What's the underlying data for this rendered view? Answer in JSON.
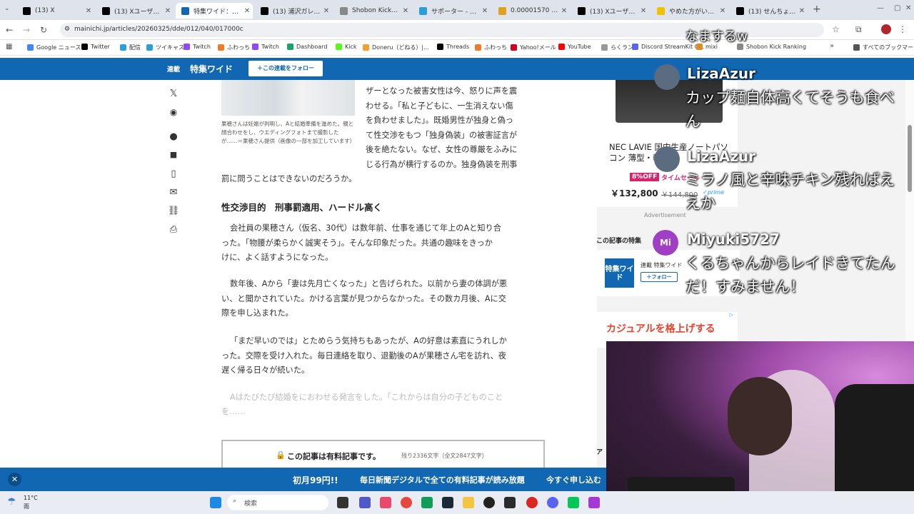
{
  "tabs": [
    {
      "label": "(13) X",
      "color": "#000000"
    },
    {
      "label": "(13) Xユーザーの新",
      "color": "#000000"
    },
    {
      "label": "特集ワイド：BeMe",
      "color": "#1167b1",
      "active": true
    },
    {
      "label": "(13) 浦沢ガレン（@",
      "color": "#000000"
    },
    {
      "label": "Shobon Kick Rank",
      "color": "#888888"
    },
    {
      "label": "サポーター - せんちょ",
      "color": "#2b9fd9"
    },
    {
      "label": "0.00001570 | AXS",
      "color": "#e0a020"
    },
    {
      "label": "(13) Xユーザーの新",
      "color": "#000000"
    },
    {
      "label": "やめた方がいい！ブ",
      "color": "#f2c200"
    },
    {
      "label": "(13) せんちょさん（@",
      "color": "#000000"
    }
  ],
  "address": {
    "url": "mainichi.jp/articles/20260325/dde/012/040/017000c"
  },
  "bookmarks": [
    {
      "label": "Google ニュース",
      "color": "#4285f4"
    },
    {
      "label": "Twitter",
      "color": "#000000"
    },
    {
      "label": "配信",
      "color": "#2b9fd9"
    },
    {
      "label": "ツイキャス",
      "color": "#2b9fd9"
    },
    {
      "label": "Twitch",
      "color": "#9146ff"
    },
    {
      "label": "ふわっち",
      "color": "#f07c2a"
    },
    {
      "label": "Twitch",
      "color": "#9146ff"
    },
    {
      "label": "Dashboard",
      "color": "#1aa36a"
    },
    {
      "label": "Kick",
      "color": "#53fc18"
    },
    {
      "label": "Doneru（どねる）|...",
      "color": "#f2a12e"
    },
    {
      "label": "Threads",
      "color": "#000000"
    },
    {
      "label": "ふわっち",
      "color": "#f07c2a"
    },
    {
      "label": "Yahoo!メール",
      "color": "#d1001c"
    },
    {
      "label": "YouTube",
      "color": "#ff0000"
    },
    {
      "label": "らくラン",
      "color": "#999999"
    },
    {
      "label": "Discord StreamKit O...",
      "color": "#5865f2"
    },
    {
      "label": "mixi",
      "color": "#e28a1f"
    },
    {
      "label": "Shobon Kick Ranking",
      "color": "#888888"
    },
    {
      "label": "すべてのブックマーク",
      "color": "#555555"
    }
  ],
  "site_header": {
    "series": "連載",
    "name": "特集ワイド",
    "follow_button": "＋この連載をフォロー"
  },
  "article": {
    "caption": "果穂さんは妊娠が判明し、Aと結婚準備を進めた。親と顔合わせをし、ウエディングフォトまで撮影したが……＝果穂さん提供（画像の一部を加工しています）",
    "intro_lines": [
      "ザーとなった被害女性は今、怒りに声を震",
      "わせる。「私と子どもに、一生消えない傷",
      "を負わせました」。既婚男性が独身と偽っ",
      "て性交渉をもつ「独身偽装」の被害証言が",
      "後を絶たない。なぜ、女性の尊厳をふみに",
      "じる行為が横行するのか。独身偽装を刑事"
    ],
    "intro_last": "罰に問うことはできないのだろうか。",
    "heading": "性交渉目的　刑事罰適用、ハードル高く",
    "p1": [
      "会社員の果穂さん（仮名、30代）は数年前、仕事を通じて年上のAと知り合",
      "った。「物腰が柔らかく誠実そう」。そんな印象だった。共通の趣味をきっか",
      "けに、よく話すようになった。"
    ],
    "p2": [
      "数年後、Aから「妻は先月亡くなった」と告げられた。以前から妻の体調が悪",
      "い、と聞かされていた。かける言葉が見つからなかった。その数カ月後、Aに交",
      "際を申し込まれた。"
    ],
    "p3": [
      "「まだ早いのでは」とためらう気持ちもあったが、Aの好意は素直にうれしか",
      "った。交際を受け入れた。毎日連絡を取り、退勤後のAが果穂さん宅を訪れ、夜",
      "遅く帰る日々が続いた。"
    ],
    "p4": [
      "Aはたびたび結婚をにおわせる発言をした。「これからは自分の子どものこと",
      "を……"
    ]
  },
  "paywall": {
    "lock": "🔒",
    "title": "この記事は有料記事です。",
    "remaining": "残り2336文字（全文2847文字）"
  },
  "sidebar": {
    "ad_title": "NEC LAVIE 国内生産ノートパソコン 薄型・軽量",
    "discount": "8%OFF",
    "timesale": "タイムセール",
    "price": "￥132,800",
    "old_price": "￥144,800",
    "prime": "✓prime",
    "advertisement": "Advertisement",
    "series_label": "この記事の特集",
    "series_logo": "特集ワイド",
    "series_card_label": "連載  特集ワイド",
    "series_follow": "＋フォロー",
    "ad2": "カジュアルを格上げする",
    "cut": "ア"
  },
  "chat": [
    {
      "name": "LizaAzur",
      "text": "カップ麺自体高くてそうも食べん"
    },
    {
      "name": "LizaAzur",
      "text": "ミラノ風と辛味チキン残ればええか"
    },
    {
      "name": "Miyuki5727",
      "avatar_initials": "Mi",
      "text": "くるちゃんからレイドきてたんだ！すみません！"
    }
  ],
  "chat_top_fragment": "なまするw",
  "promo": {
    "a": "初月99円!!",
    "b": "毎日新聞デジタルで全ての有料記事が読み放題",
    "c": "今すぐ申し込む"
  },
  "taskbar": {
    "weather_temp": "11°C",
    "weather_cond": "雨",
    "search": "検索"
  }
}
